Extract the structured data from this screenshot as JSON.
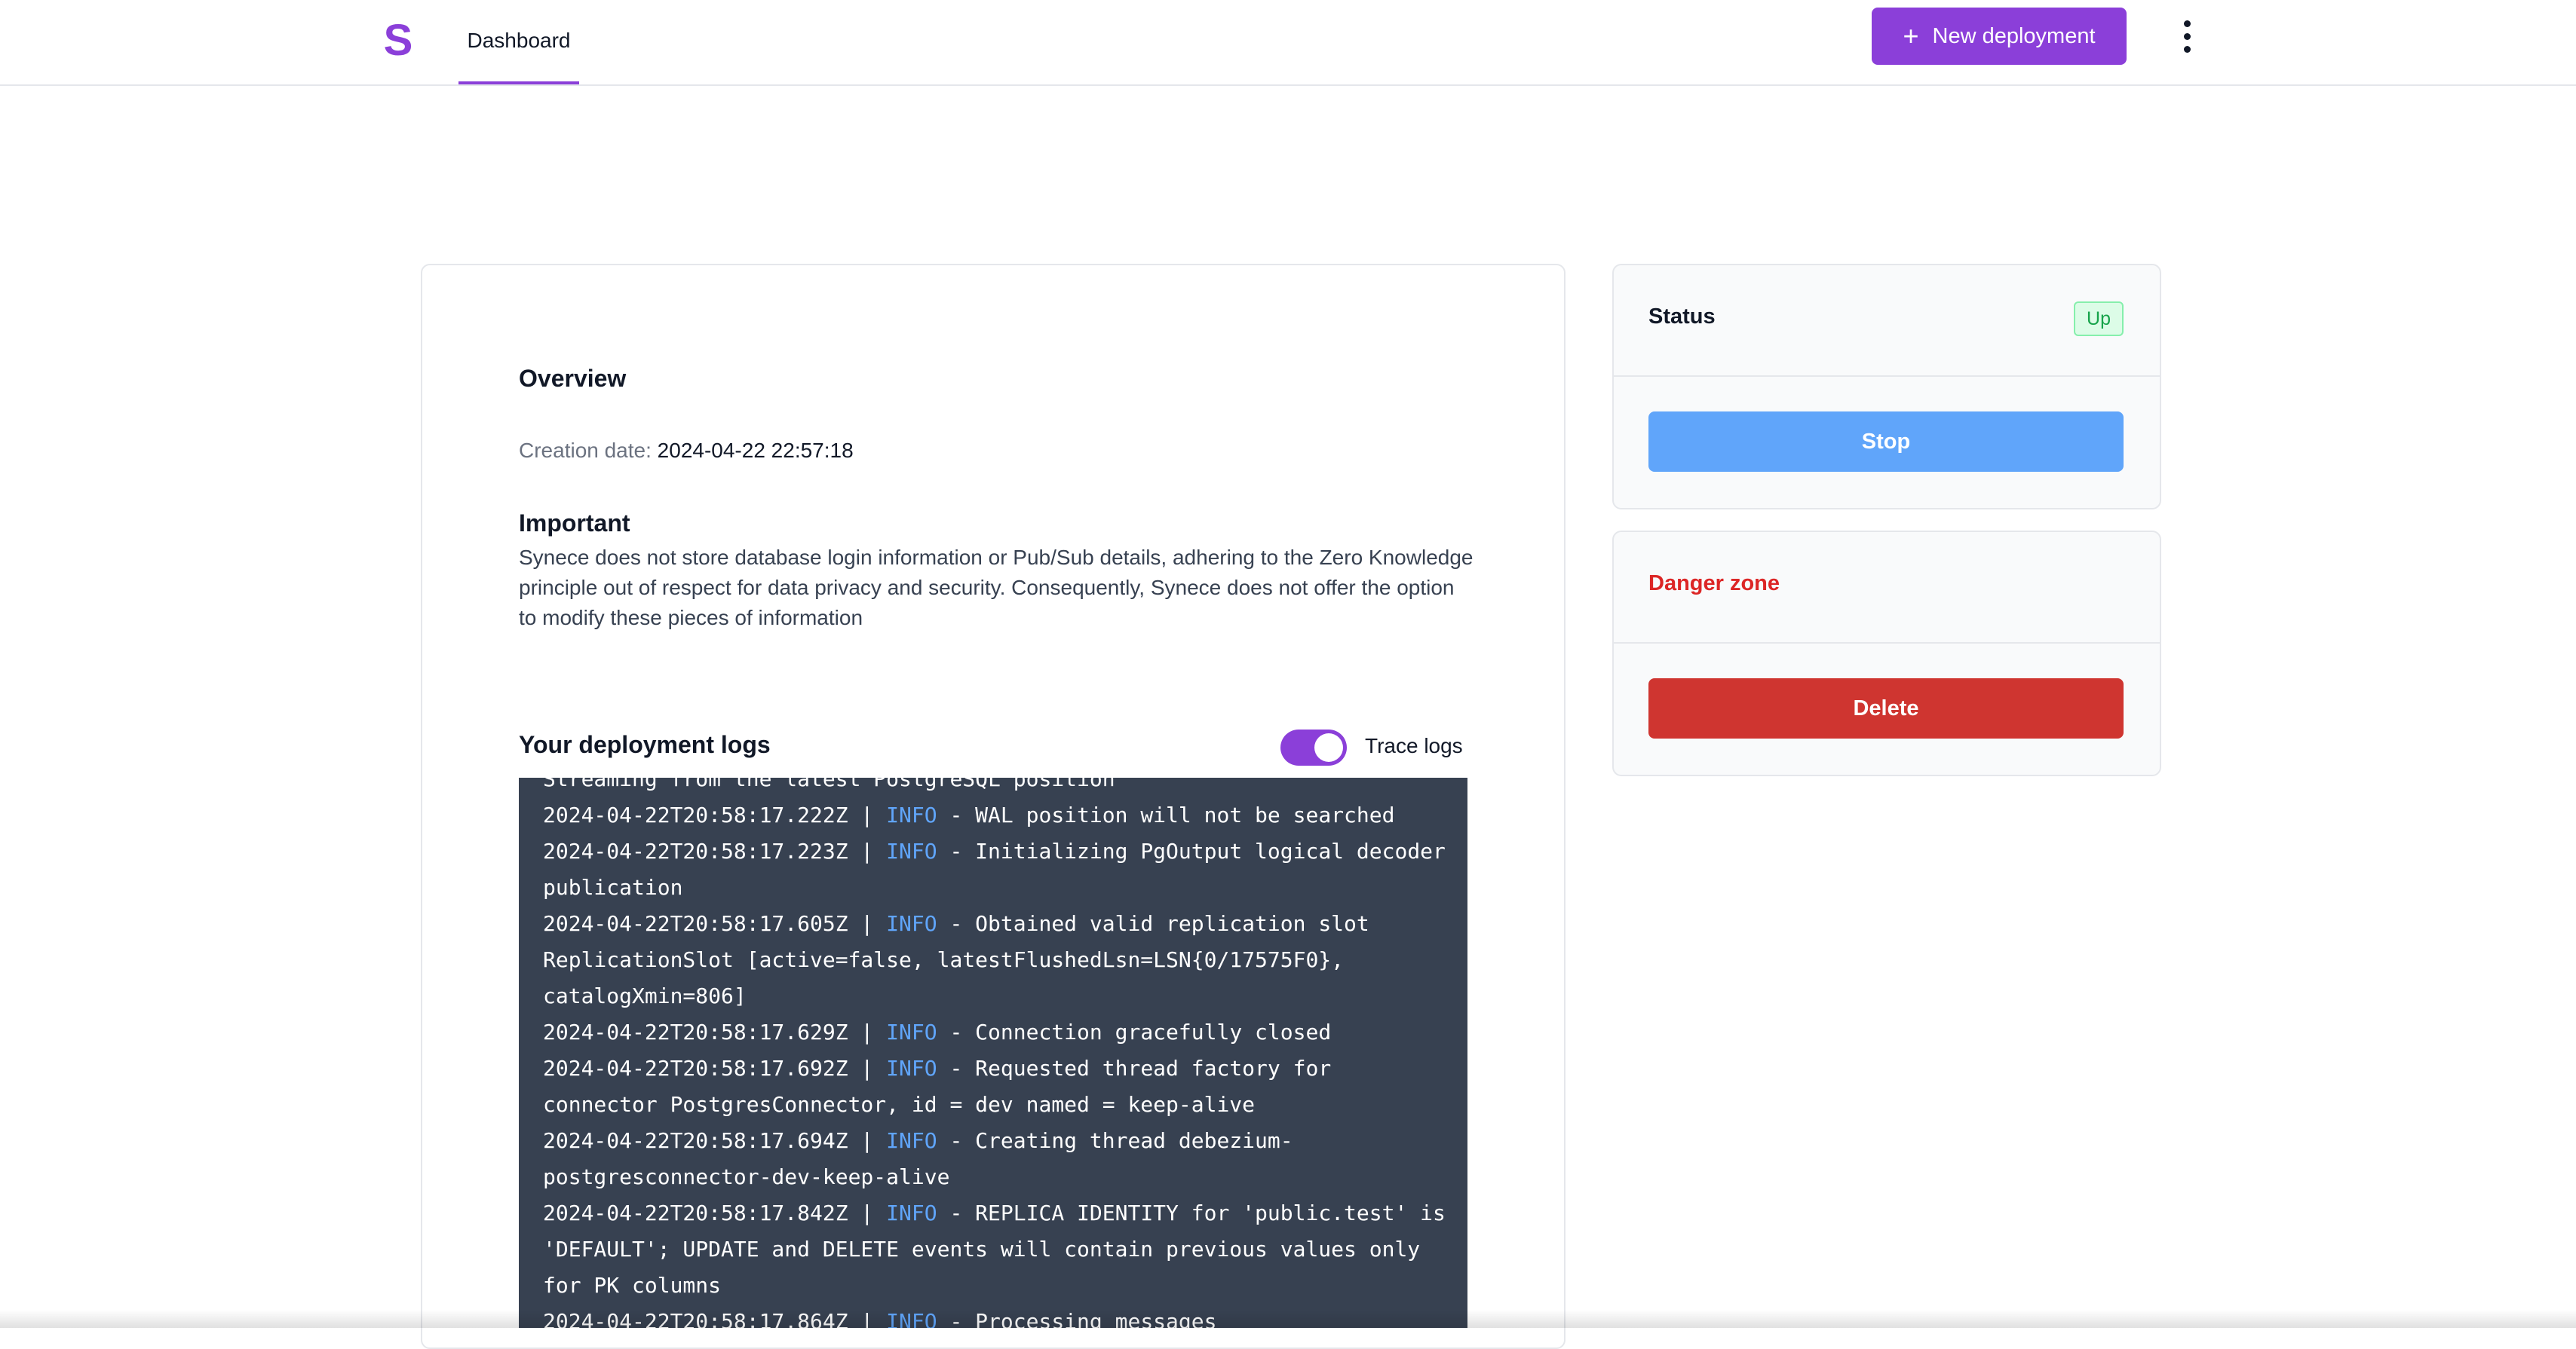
{
  "header": {
    "logo": "S",
    "tab_dashboard": "Dashboard",
    "new_deployment_label": "New deployment",
    "new_deployment_icon": "plus-icon",
    "menu_icon": "kebab-menu-icon"
  },
  "overview": {
    "title": "Overview",
    "creation_label": "Creation date:",
    "creation_value": "2024-04-22 22:57:18",
    "important_title": "Important",
    "important_text": "Synece does not store database login information or Pub/Sub details, adhering to the Zero Knowledge principle out of respect for data privacy and security. Consequently, Synece does not offer the option to modify these pieces of information"
  },
  "logs": {
    "title": "Your deployment logs",
    "trace_label": "Trace logs",
    "trace_enabled": true,
    "partial_top_line": "Streaming from the latest PostgreSQL position",
    "lines": [
      {
        "ts": "2024-04-22T20:58:17.222Z",
        "level": "INFO",
        "msg": "WAL position will not be searched"
      },
      {
        "ts": "2024-04-22T20:58:17.223Z",
        "level": "INFO",
        "msg": "Initializing PgOutput logical decoder publication"
      },
      {
        "ts": "2024-04-22T20:58:17.605Z",
        "level": "INFO",
        "msg": "Obtained valid replication slot ReplicationSlot [active=false, latestFlushedLsn=LSN{0/17575F0}, catalogXmin=806]"
      },
      {
        "ts": "2024-04-22T20:58:17.629Z",
        "level": "INFO",
        "msg": "Connection gracefully closed"
      },
      {
        "ts": "2024-04-22T20:58:17.692Z",
        "level": "INFO",
        "msg": "Requested thread factory for connector PostgresConnector, id = dev named = keep-alive"
      },
      {
        "ts": "2024-04-22T20:58:17.694Z",
        "level": "INFO",
        "msg": "Creating thread debezium-postgresconnector-dev-keep-alive"
      },
      {
        "ts": "2024-04-22T20:58:17.842Z",
        "level": "INFO",
        "msg": "REPLICA IDENTITY for 'public.test' is 'DEFAULT'; UPDATE and DELETE events will contain previous values only for PK columns"
      },
      {
        "ts": "2024-04-22T20:58:17.864Z",
        "level": "INFO",
        "msg": "Processing messages"
      }
    ]
  },
  "status": {
    "title": "Status",
    "badge": "Up",
    "badge_color": "#16a34a",
    "stop_label": "Stop"
  },
  "danger": {
    "title": "Danger zone",
    "delete_label": "Delete",
    "color": "#cf3530"
  },
  "colors": {
    "accent": "#8b3fd9",
    "stop": "#60a5fa",
    "log_bg": "#374151",
    "log_level": "#60a5fa"
  }
}
